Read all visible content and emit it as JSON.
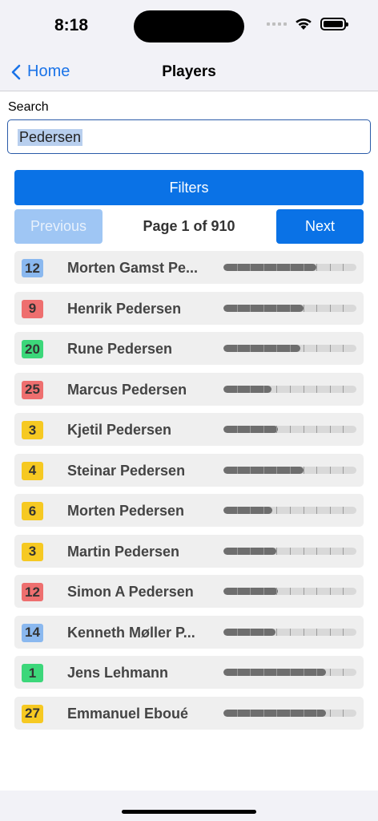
{
  "status": {
    "time": "8:18"
  },
  "nav": {
    "back_label": "Home",
    "title": "Players"
  },
  "search": {
    "label": "Search",
    "value": "Pedersen"
  },
  "filters": {
    "label": "Filters"
  },
  "pagination": {
    "previous_label": "Previous",
    "page_text": "Page 1 of 910",
    "next_label": "Next"
  },
  "colors": {
    "accent": "#0a72e6",
    "blue_badge": "#8ab8ef",
    "red_badge": "#ee6f6f",
    "green_badge": "#3cd77a",
    "yellow_badge": "#f6c922"
  },
  "players": [
    {
      "rating": "12",
      "name": "Morten Gamst Pe...",
      "badge_color": "#8ab8ef",
      "bar_fraction": 0.7
    },
    {
      "rating": "9",
      "name": "Henrik Pedersen",
      "badge_color": "#ee6f6f",
      "bar_fraction": 0.6
    },
    {
      "rating": "20",
      "name": "Rune Pedersen",
      "badge_color": "#3cd77a",
      "bar_fraction": 0.58
    },
    {
      "rating": "25",
      "name": "Marcus Pedersen",
      "badge_color": "#ee6f6f",
      "bar_fraction": 0.36
    },
    {
      "rating": "3",
      "name": "Kjetil Pedersen",
      "badge_color": "#f6c922",
      "bar_fraction": 0.41
    },
    {
      "rating": "4",
      "name": "Steinar Pedersen",
      "badge_color": "#f6c922",
      "bar_fraction": 0.6
    },
    {
      "rating": "6",
      "name": "Morten Pedersen",
      "badge_color": "#f6c922",
      "bar_fraction": 0.37
    },
    {
      "rating": "3",
      "name": "Martin Pedersen",
      "badge_color": "#f6c922",
      "bar_fraction": 0.4
    },
    {
      "rating": "12",
      "name": "Simon A Pedersen",
      "badge_color": "#ee6f6f",
      "bar_fraction": 0.41
    },
    {
      "rating": "14",
      "name": "Kenneth Møller P...",
      "badge_color": "#8ab8ef",
      "bar_fraction": 0.39
    },
    {
      "rating": "1",
      "name": "Jens Lehmann",
      "badge_color": "#3cd77a",
      "bar_fraction": 0.77
    },
    {
      "rating": "27",
      "name": "Emmanuel Eboué",
      "badge_color": "#f6c922",
      "bar_fraction": 0.77
    }
  ]
}
